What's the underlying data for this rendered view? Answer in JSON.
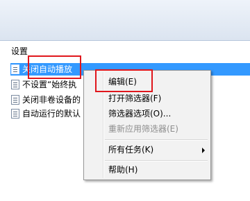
{
  "section": {
    "header": "设置"
  },
  "list": {
    "rows": [
      {
        "label": "关闭自动播放",
        "selected": true,
        "icon": "policy-setting-icon"
      },
      {
        "label": "不设置“始终执",
        "selected": false,
        "icon": "policy-setting-icon"
      },
      {
        "label": "关闭非卷设备的",
        "selected": false,
        "icon": "policy-setting-icon"
      },
      {
        "label": "自动运行的默认",
        "selected": false,
        "icon": "policy-setting-icon"
      }
    ]
  },
  "context_menu": {
    "items": [
      {
        "label": "编辑(E)",
        "enabled": true
      },
      {
        "label": "打开筛选器(F)",
        "enabled": true
      },
      {
        "label": "筛选器选项(O)...",
        "enabled": true
      },
      {
        "label": "重新应用筛选器(E)",
        "enabled": false
      },
      {
        "label": "所有任务(K)",
        "enabled": true,
        "submenu": true,
        "submenu_icon": "chevron-right-icon"
      },
      {
        "label": "帮助(H)",
        "enabled": true
      }
    ]
  },
  "colors": {
    "selection": "#3399ff",
    "annotation_box": "#e0161c",
    "menu_background": "#f2f2f2",
    "disabled_text": "#8d8d8d"
  }
}
